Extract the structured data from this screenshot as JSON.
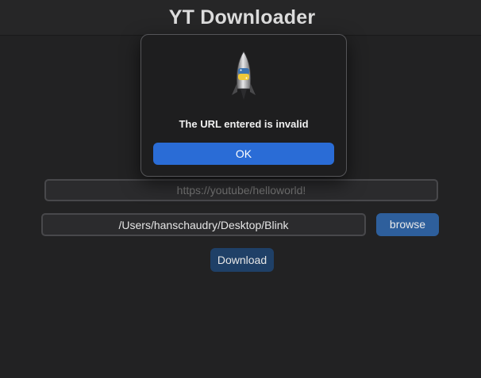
{
  "window": {
    "title": "YT Downloader"
  },
  "form": {
    "url_placeholder": "https://youtube/helloworld!",
    "path_value": "/Users/hanschaudry/Desktop/Blink",
    "browse_label": "browse",
    "download_label": "Download"
  },
  "dialog": {
    "icon": "python-rocket-icon",
    "message": "The URL entered is invalid",
    "ok_label": "OK"
  },
  "colors": {
    "accent": "#2a6cd6",
    "browse": "#2e5f9c",
    "download": "#1f4067",
    "background": "#222223"
  }
}
